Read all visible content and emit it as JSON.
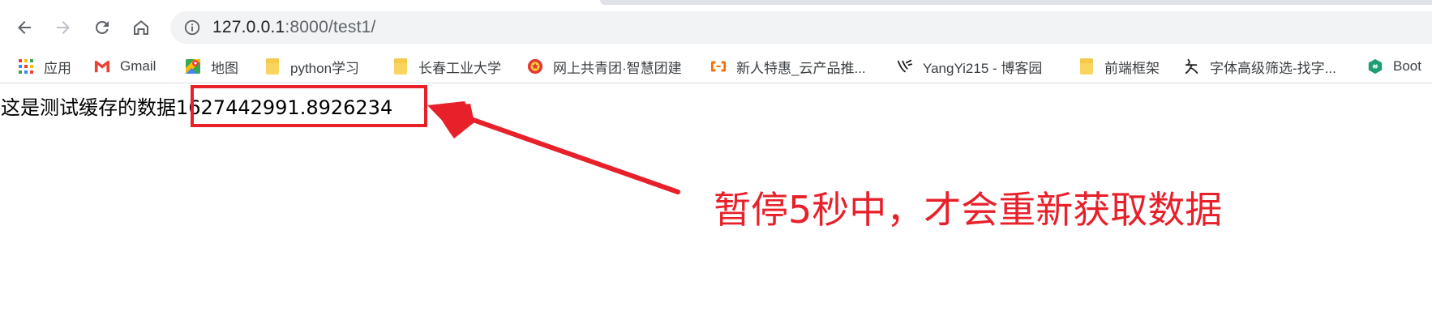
{
  "toolbar": {
    "back_icon": "arrow-left-icon",
    "forward_icon": "arrow-right-icon",
    "reload_icon": "reload-icon",
    "home_icon": "home-icon",
    "info_icon": "info-icon",
    "url_host": "127.0.0.1",
    "url_path": ":8000/test1/"
  },
  "bookmarks": [
    {
      "label": "应用",
      "icon": "apps-grid-icon"
    },
    {
      "label": "Gmail",
      "icon": "gmail-icon"
    },
    {
      "label": "地图",
      "icon": "maps-icon"
    },
    {
      "label": "python学习",
      "icon": "folder-icon"
    },
    {
      "label": "长春工业大学",
      "icon": "folder-icon"
    },
    {
      "label": "网上共青团·智慧团建",
      "icon": "league-badge-icon"
    },
    {
      "label": "新人特惠_云产品推...",
      "icon": "aliyun-icon"
    },
    {
      "label": "YangYi215 - 博客园",
      "icon": "cnblogs-icon"
    },
    {
      "label": "前端框架",
      "icon": "folder-icon"
    },
    {
      "label": "字体高级筛选-找字...",
      "icon": "font-site-icon"
    },
    {
      "label": "Boot",
      "icon": "bootcdn-icon"
    }
  ],
  "page": {
    "prefix_text": "这是测试缓存的数据",
    "timestamp": "1627442991.8926234"
  },
  "annotation": {
    "text": "暂停5秒中，才会重新获取数据",
    "color": "#e8202a"
  }
}
